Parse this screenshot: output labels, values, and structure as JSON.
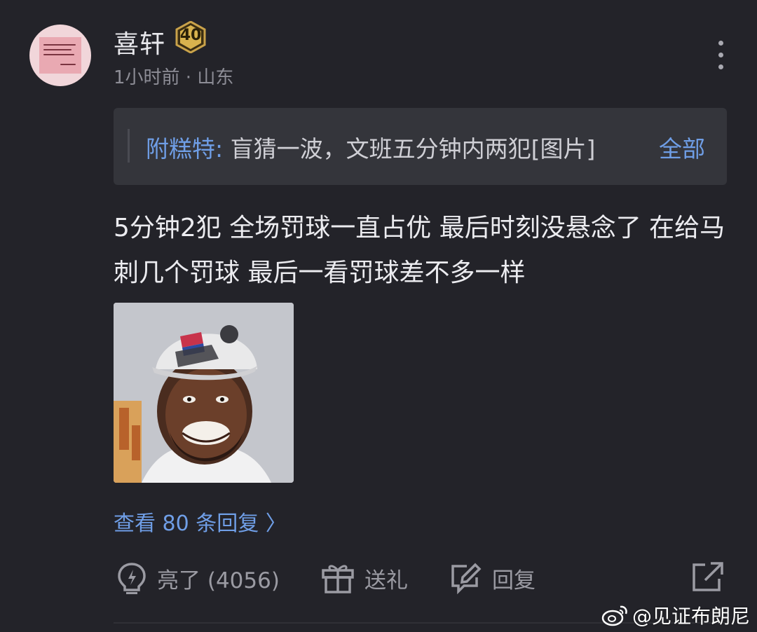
{
  "post": {
    "username": "喜轩",
    "level": "40",
    "meta": "1小时前 · 山东",
    "quote": {
      "author": "附糕特:",
      "content": " 盲猜一波，文班五分钟内两犯[图片]",
      "expand_label": "全部"
    },
    "body": "5分钟2犯 全场罚球一直占优  最后时刻没悬念了 在给马刺几个罚球 最后一看罚球差不多一样",
    "view_replies": "查看 80 条回复 〉"
  },
  "actions": {
    "like_label": "亮了 (4056)",
    "gift_label": "送礼",
    "reply_label": "回复"
  },
  "watermark": "@见证布朗尼",
  "colors": {
    "background": "#232329",
    "accent_blue": "#6f9ee6",
    "quote_bg": "#34353b"
  }
}
